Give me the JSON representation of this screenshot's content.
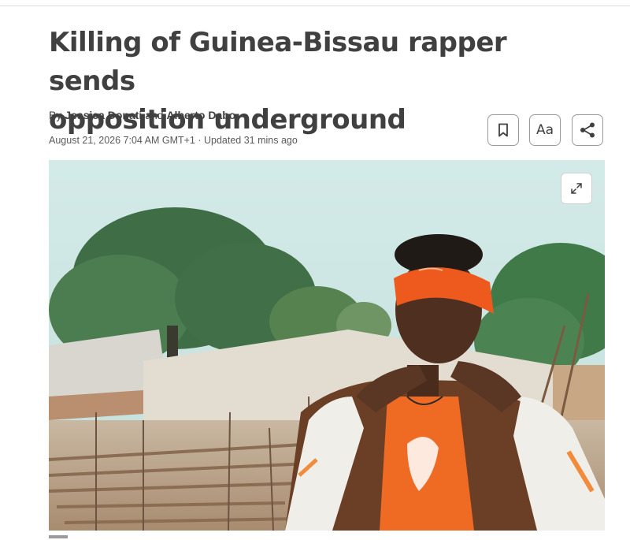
{
  "article": {
    "headline_line1": "Killing of Guinea-Bissau rapper sends",
    "headline_line2": "opposition underground",
    "byline": {
      "prefix": "By",
      "author1": "Jessica Donati",
      "joiner": "and",
      "author2": "Alberto Dabo"
    },
    "dateline": "August 21, 2026 7:04 AM GMT+1 · Updated 31 mins ago"
  },
  "toolbar": {
    "bookmark_icon": "bookmark-icon",
    "textsize_label": "Aa",
    "share_icon": "share-icon"
  },
  "media": {
    "expand_icon": "expand-icon",
    "colors": {
      "sky": "#cfe6e4",
      "headband": "#ee5a1e",
      "jacket": "#6b3e26"
    }
  }
}
